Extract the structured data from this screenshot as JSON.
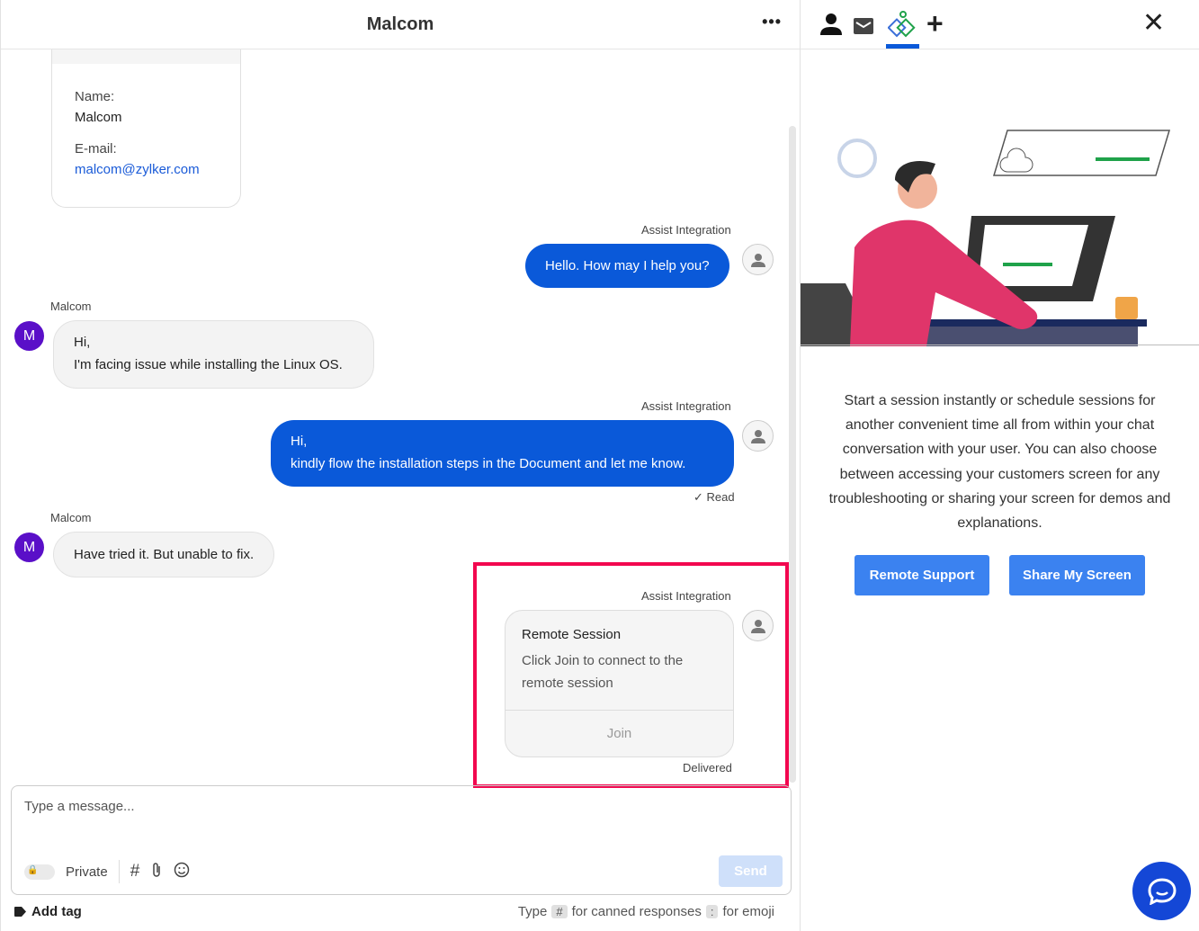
{
  "header": {
    "title": "Malcom",
    "more": "•••"
  },
  "contact": {
    "name_label": "Name:",
    "name": "Malcom",
    "email_label": "E-mail:",
    "email": "malcom@zylker.com"
  },
  "messages": [
    {
      "sender": "Assist Integration",
      "lines": [
        "Hello. How may I help you?"
      ]
    },
    {
      "sender": "Malcom",
      "avatar": "M",
      "lines": [
        "Hi,",
        "I'm facing issue while installing the Linux OS."
      ]
    },
    {
      "sender": "Assist Integration",
      "lines": [
        "Hi,",
        "kindly flow the installation steps in the Document and let me know."
      ],
      "status": "✓ Read"
    },
    {
      "sender": "Malcom",
      "avatar": "M",
      "lines": [
        "Have tried it. But unable to fix."
      ]
    },
    {
      "sender": "Assist Integration",
      "card": {
        "title": "Remote Session",
        "desc": "Click Join to connect to the remote session",
        "action": "Join"
      },
      "status": "Delivered"
    }
  ],
  "composer": {
    "placeholder": "Type a message...",
    "private": "Private",
    "send": "Send",
    "add_tag": "Add tag",
    "hint_type": "Type",
    "hint_key1": "#",
    "hint_mid": "for canned responses",
    "hint_key2": ":",
    "hint_end": "for emoji"
  },
  "panel": {
    "description": "Start a session instantly or schedule sessions for another convenient time all from within your chat conversation with your user. You can also choose between accessing your customers screen for any troubleshooting or sharing your screen for demos and explanations.",
    "remote_support": "Remote Support",
    "share_screen": "Share My Screen",
    "accent": "#0a59d9"
  }
}
